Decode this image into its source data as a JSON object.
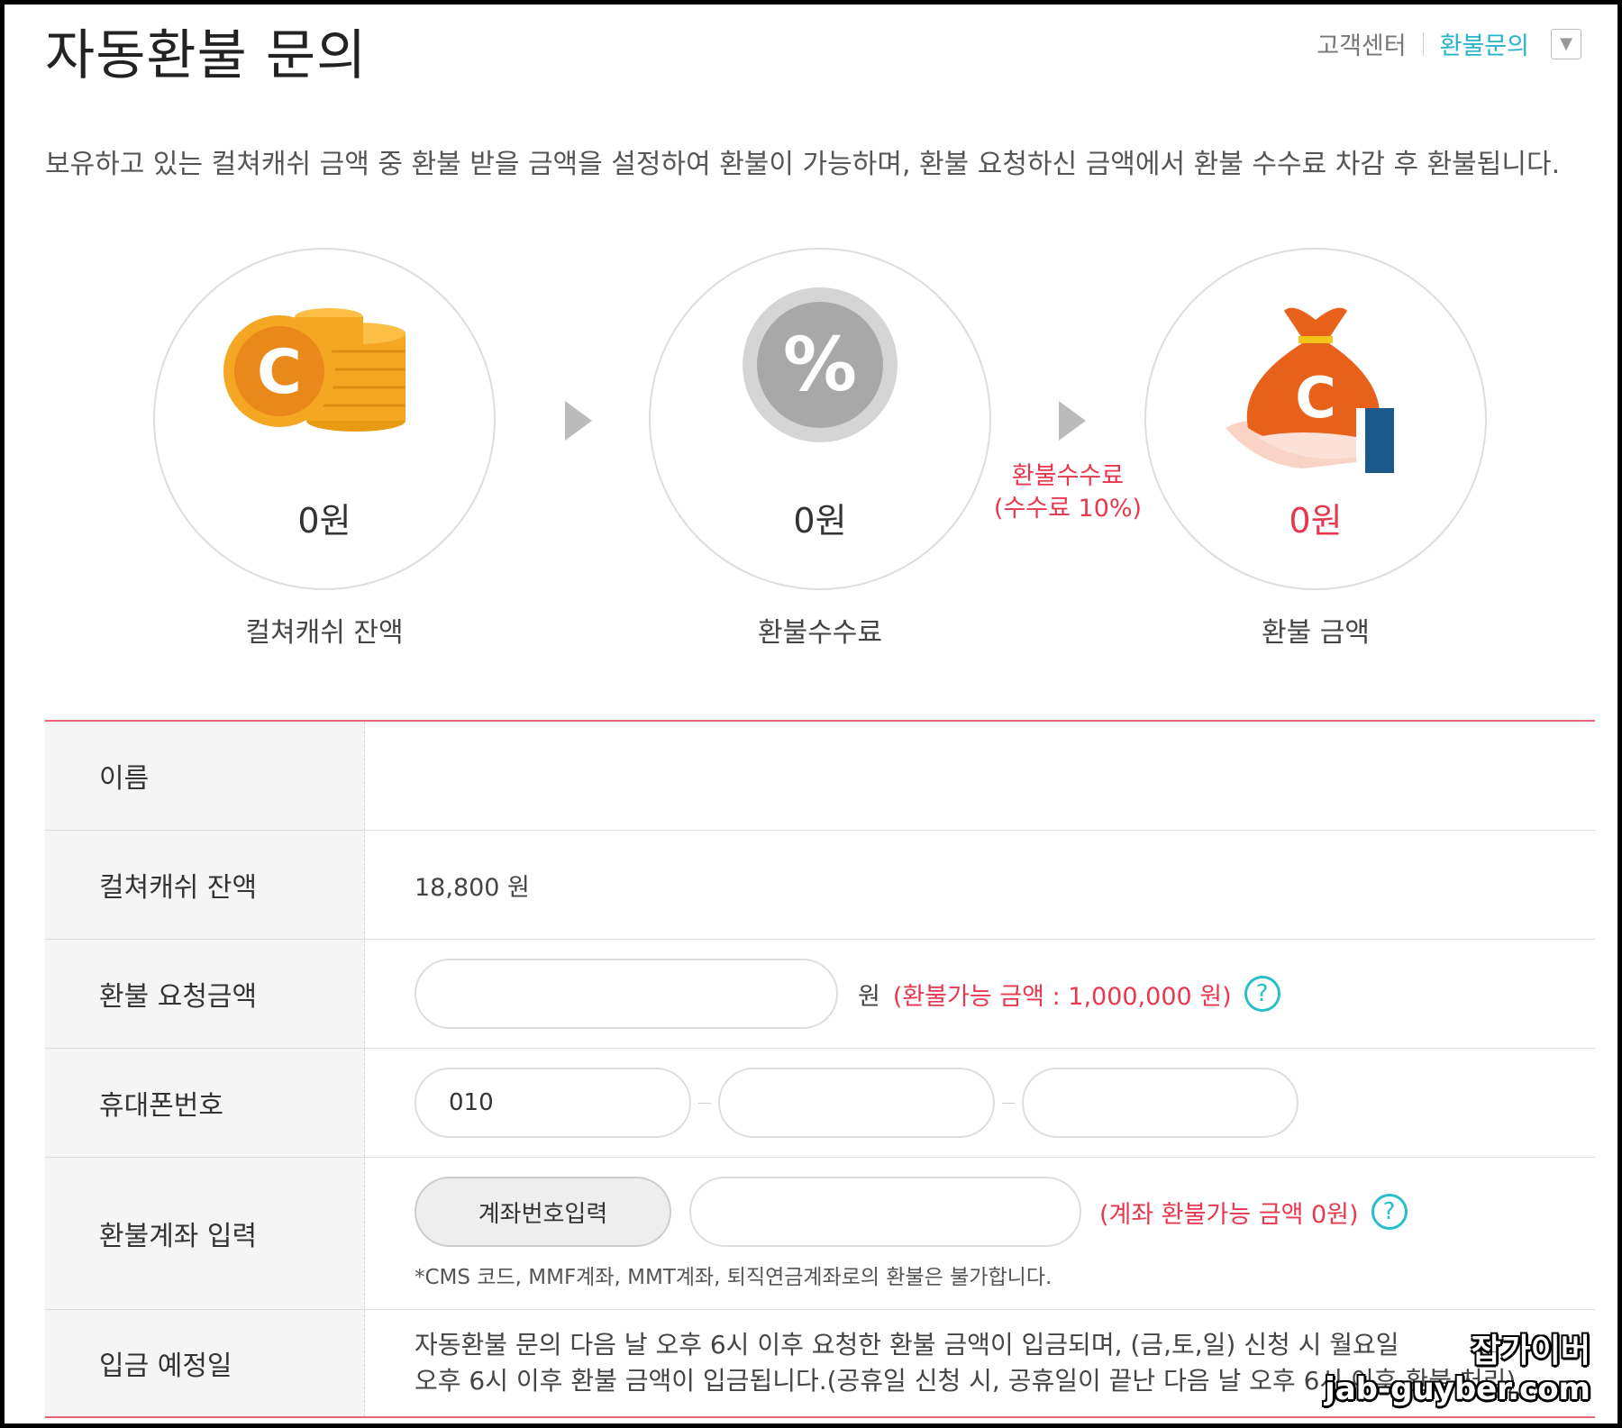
{
  "page": {
    "title": "자동환불 문의"
  },
  "breadcrumb": {
    "home": "고객센터",
    "current": "환불문의",
    "dropdown_icon": "▼"
  },
  "intro": "보유하고 있는 컬쳐캐쉬 금액 중 환불 받을 금액을 설정하여 환불이 가능하며, 환불 요청하신 금액에서 환불 수수료 차감 후 환불됩니다.",
  "steps": [
    {
      "icon": "coins-icon",
      "amount": "0원",
      "caption": "컬쳐캐쉬 잔액"
    },
    {
      "icon": "percent-icon",
      "amount": "0원",
      "caption": "환불수수료"
    },
    {
      "icon": "money-bag-hand-icon",
      "amount": "0원",
      "caption": "환불 금액"
    }
  ],
  "fee_note": {
    "line1": "환불수수료",
    "line2": "(수수료 10%)"
  },
  "form": {
    "name": {
      "label": "이름",
      "value": ""
    },
    "balance": {
      "label": "컬쳐캐쉬 잔액",
      "value": "18,800 원"
    },
    "refund_amount": {
      "label": "환불 요청금액",
      "value": "",
      "unit": "원",
      "hint": "(환불가능 금액 : 1,000,000 원)"
    },
    "phone": {
      "label": "휴대폰번호",
      "part1": "010",
      "part2": "",
      "part3": ""
    },
    "account": {
      "label": "환불계좌 입력",
      "button": "계좌번호입력",
      "value": "",
      "hint": "(계좌 환불가능 금액 0원)",
      "note": "*CMS 코드, MMF계좌, MMT계좌, 퇴직연금계좌로의 환불은 불가합니다."
    },
    "deposit_date": {
      "label": "입금 예정일",
      "line1": "자동환불 문의 다음 날 오후 6시 이후 요청한 환불 금액이 입금되며, (금,토,일) 신청 시 월요일",
      "line2": "오후 6시 이후 환불 금액이 입금됩니다.(공휴일 신청 시, 공휴일이 끝난 다음 날 오후 6시 이후 환불 처리)"
    }
  },
  "help_icon": "?",
  "watermark": {
    "line1": "잡가이버",
    "line2": "jab-guyber.com"
  },
  "colors": {
    "accent_red": "#e8384f",
    "accent_teal": "#28b4c8",
    "coin_orange": "#f5a623",
    "bag_orange": "#e8611a"
  }
}
